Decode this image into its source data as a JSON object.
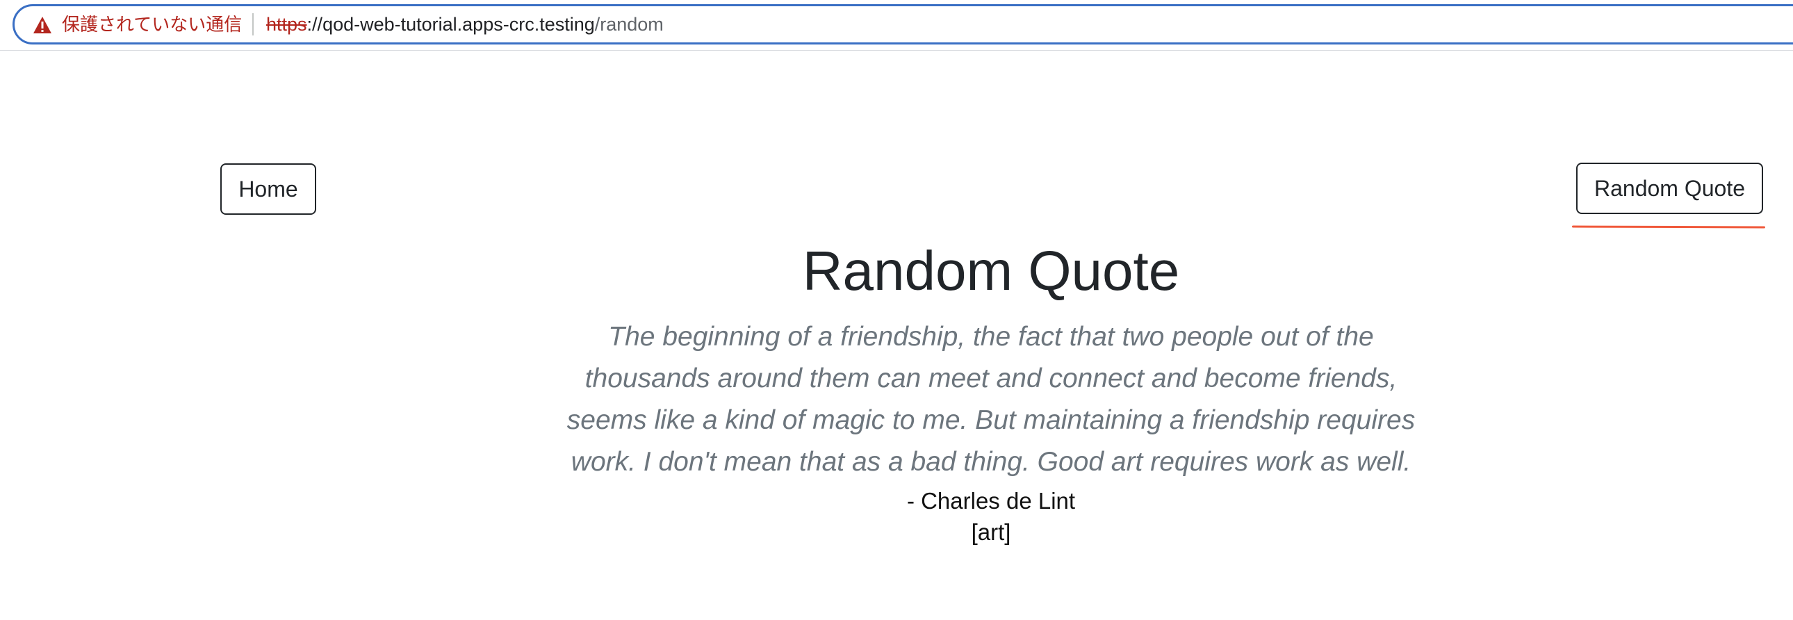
{
  "browser": {
    "security_label": "保護されていない通信",
    "url_scheme": "https",
    "url_separator": "://",
    "url_host": "qod-web-tutorial.apps-crc.testing",
    "url_path": "/random",
    "warning_color": "#b3261e",
    "focus_ring_color": "#3a6fc4"
  },
  "nav": {
    "home_label": "Home",
    "random_label": "Random Quote"
  },
  "page": {
    "title": "Random Quote",
    "quote": "The beginning of a friendship, the fact that two people out of the thousands around them can meet and connect and become friends, seems like a kind of magic to me. But maintaining a friendship requires work. I don't mean that as a bad thing. Good art requires work as well.",
    "author": "- Charles de Lint",
    "tag": "[art]"
  },
  "annotation": {
    "underline_color": "#f05a3c"
  }
}
